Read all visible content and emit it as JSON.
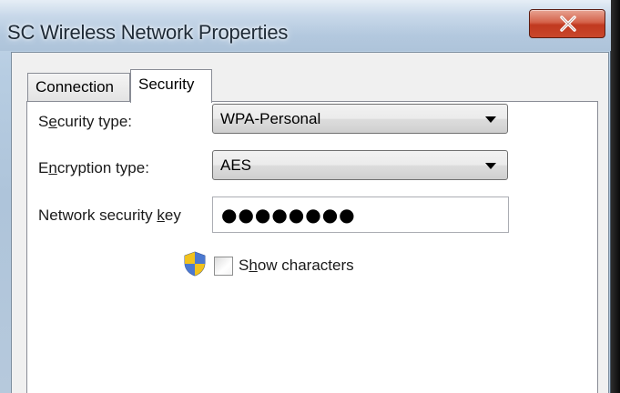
{
  "window": {
    "title": "SC Wireless Network Properties"
  },
  "tabs": [
    {
      "label": "Connection",
      "selected": false
    },
    {
      "label": "Security",
      "selected": true
    }
  ],
  "security": {
    "security_type": {
      "label_pre": "S",
      "label_mnemonic": "e",
      "label_post": "curity type:",
      "value": "WPA-Personal"
    },
    "encryption_type": {
      "label_pre": "E",
      "label_mnemonic": "n",
      "label_post": "cryption type:",
      "value": "AES"
    },
    "network_key": {
      "label_pre": "Network security ",
      "label_mnemonic": "k",
      "label_post": "ey",
      "masked_value": "●●●●●●●●"
    },
    "show_characters": {
      "label_pre": "S",
      "label_mnemonic": "h",
      "label_post": "ow characters",
      "checked": false
    }
  },
  "icons": {
    "close": "close-icon",
    "dropdown": "chevron-down-icon",
    "shield": "uac-shield-icon"
  },
  "colors": {
    "close_button": "#c9472b",
    "title_glass": "#b3c8de"
  }
}
